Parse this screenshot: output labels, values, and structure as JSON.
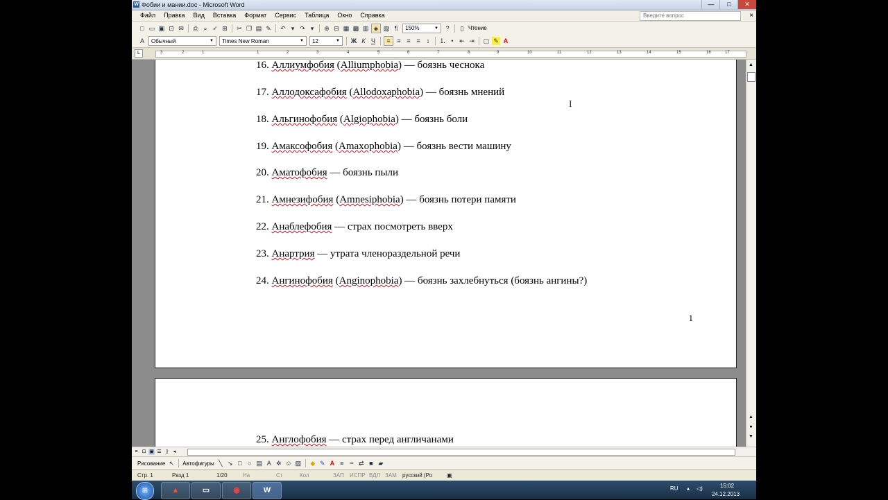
{
  "window": {
    "title": "Фобии и мании.doc - Microsoft Word",
    "minimize": "—",
    "maximize": "□",
    "close": "✕"
  },
  "menu": {
    "items": [
      "Файл",
      "Правка",
      "Вид",
      "Вставка",
      "Формат",
      "Сервис",
      "Таблица",
      "Окно",
      "Справка"
    ],
    "help_placeholder": "Введите вопрос",
    "doc_close": "×"
  },
  "toolbar": {
    "zoom": "150%",
    "reading_label": "Чтение"
  },
  "format": {
    "style": "Обычный",
    "font": "Times New Roman",
    "size": "12",
    "bold": "Ж",
    "italic": "К",
    "underline": "Ч"
  },
  "ruler": {
    "numbers": [
      "3",
      "2",
      "1",
      "1",
      "2",
      "3",
      "4",
      "5",
      "6",
      "7",
      "8",
      "9",
      "10",
      "11",
      "12",
      "13",
      "14",
      "15",
      "16",
      "17"
    ]
  },
  "document": {
    "page1_lines": [
      {
        "num": "16.",
        "term": "Аллиумфобия",
        "latin": "Alliumphobia",
        "def": "боязнь чеснока"
      },
      {
        "num": "17.",
        "term": "Аллодоксафобия",
        "latin": "Allodoxaphobia",
        "def": "боязнь мнений"
      },
      {
        "num": "18.",
        "term": "Альгинофобия",
        "latin": "Algiophobia",
        "def": "боязнь боли"
      },
      {
        "num": "19.",
        "term": "Амаксофобия",
        "latin": "Amaxophobia",
        "def": "боязнь вести машину"
      },
      {
        "num": "20.",
        "term": "Аматофобия",
        "latin": "",
        "def": "боязнь пыли"
      },
      {
        "num": "21.",
        "term": "Амнезифобия",
        "latin": "Amnesiphobia",
        "def": "боязнь потери памяти"
      },
      {
        "num": "22.",
        "term": "Анаблефобия",
        "latin": "",
        "def": "страх посмотреть вверх"
      },
      {
        "num": "23.",
        "term": "Анартрия",
        "latin": "",
        "def": "утрата членораздельной речи"
      },
      {
        "num": "24.",
        "term": "Ангинофобия",
        "latin": "Anginophobia",
        "def": "боязнь захлебнуться (боязнь ангины?)"
      }
    ],
    "page_number": "1",
    "page2_line": {
      "num": "25.",
      "term": "Англофобия",
      "latin": "",
      "def": "страх перед англичанами"
    }
  },
  "drawing": {
    "draw_label": "Рисование",
    "autoshapes_label": "Автофигуры"
  },
  "status": {
    "page": "Стр. 1",
    "section": "Разд 1",
    "pages": "1/20",
    "at": "На",
    "line": "Ст",
    "col": "Кол",
    "rec": "ЗАП",
    "trk": "ИСПР",
    "ext": "ВДЛ",
    "ovr": "ЗАМ",
    "lang": "русский (Ро"
  },
  "taskbar": {
    "lang": "RU",
    "time": "15:02",
    "date": "24.12.2013",
    "word_glyph": "W"
  }
}
